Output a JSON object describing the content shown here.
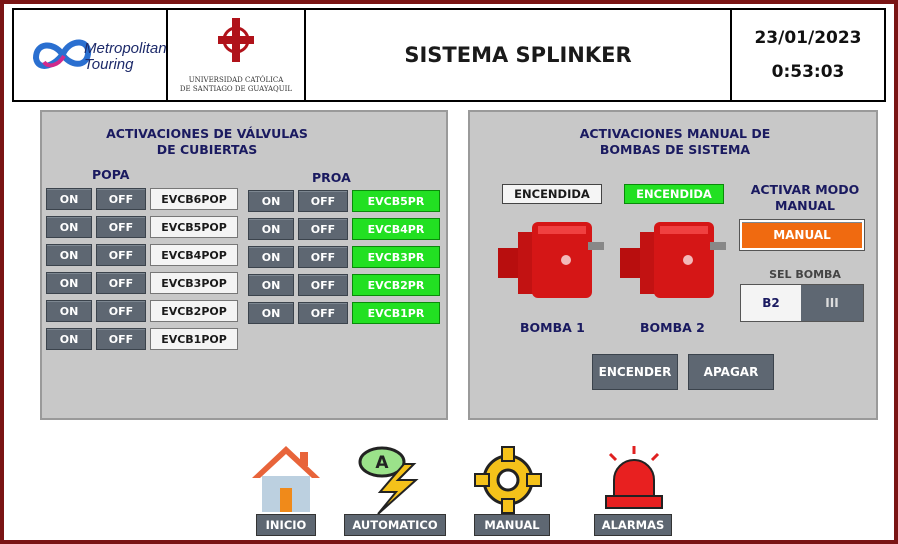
{
  "header": {
    "logo_brand_line1": "Metropolitan",
    "logo_brand_line2": "Touring",
    "university_line1": "UNIVERSIDAD CATÓLICA",
    "university_line2": "DE SANTIAGO DE GUAYAQUIL",
    "title": "SISTEMA SPLINKER",
    "date": "23/01/2023",
    "time": "0:53:03"
  },
  "valves": {
    "title_line1": "ACTIVACIONES DE VÁLVULAS",
    "title_line2": "DE CUBIERTAS",
    "popa_label": "POPA",
    "proa_label": "PROA",
    "on_label": "ON",
    "off_label": "OFF",
    "popa": [
      {
        "name": "EVCB6POP",
        "active": false
      },
      {
        "name": "EVCB5POP",
        "active": false
      },
      {
        "name": "EVCB4POP",
        "active": false
      },
      {
        "name": "EVCB3POP",
        "active": false
      },
      {
        "name": "EVCB2POP",
        "active": false
      },
      {
        "name": "EVCB1POP",
        "active": false
      }
    ],
    "proa": [
      {
        "name": "EVCB5PR",
        "active": true
      },
      {
        "name": "EVCB4PR",
        "active": true
      },
      {
        "name": "EVCB3PR",
        "active": true
      },
      {
        "name": "EVCB2PR",
        "active": true
      },
      {
        "name": "EVCB1PR",
        "active": true
      }
    ]
  },
  "pumps": {
    "title_line1": "ACTIVACIONES MANUAL DE",
    "title_line2": "BOMBAS DE SISTEMA",
    "pump1_status": "ENCENDIDA",
    "pump2_status": "ENCENDIDA",
    "pump1_label": "BOMBA 1",
    "pump2_label": "BOMBA 2",
    "mode_label_line1": "ACTIVAR MODO",
    "mode_label_line2": "MANUAL",
    "manual_button": "MANUAL",
    "sel_bomba_label": "SEL BOMBA",
    "sel_value": "B2",
    "sel_switch": "III",
    "on_button": "ENCENDER",
    "off_button": "APAGAR"
  },
  "nav": {
    "home": "INICIO",
    "auto": "AUTOMATICO",
    "manual": "MANUAL",
    "alarms": "ALARMAS"
  },
  "colors": {
    "frame": "#7a1414",
    "panel": "#c8c8c8",
    "button": "#5e6772",
    "active_green": "#22e022",
    "manual_orange": "#f06a10"
  }
}
